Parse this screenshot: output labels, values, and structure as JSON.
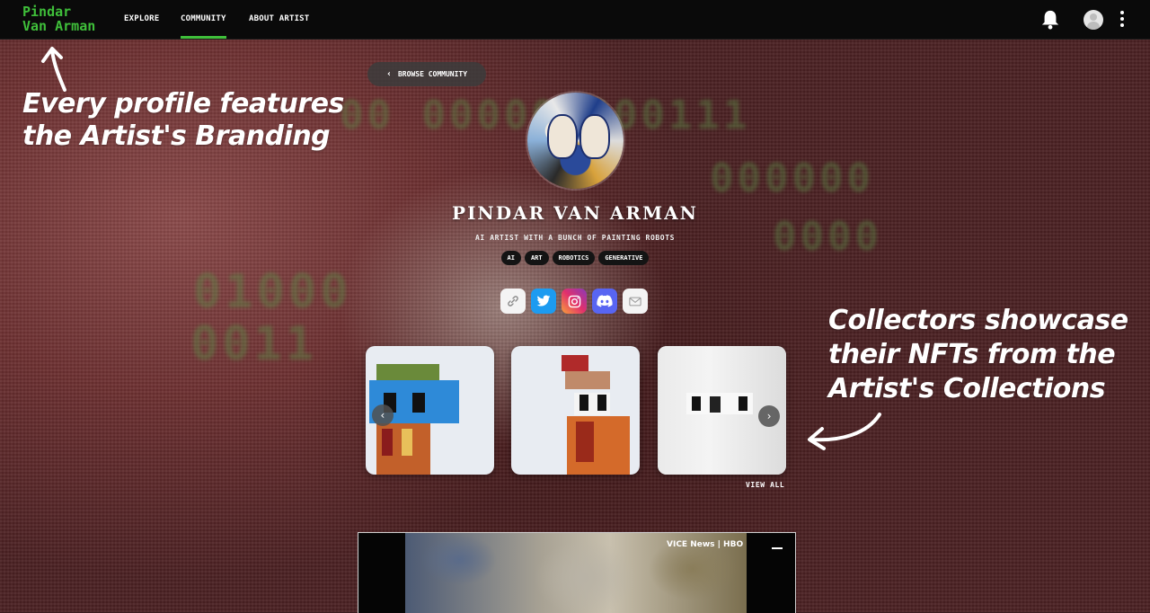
{
  "nav": {
    "brand_line1": "Pindar",
    "brand_line2": "Van Arman",
    "links": [
      "EXPLORE",
      "COMMUNITY",
      "ABOUT ARTIST"
    ],
    "active_link": "COMMUNITY",
    "icons": [
      "bell-icon",
      "user-avatar-icon",
      "more-vertical-icon"
    ]
  },
  "browse": {
    "label": "BROWSE COMMUNITY",
    "icon": "chevron-left-icon"
  },
  "profile": {
    "name": "PINDAR VAN ARMAN",
    "tagline": "AI ARTIST WITH A BUNCH OF PAINTING ROBOTS",
    "tags": [
      "AI",
      "ART",
      "ROBOTICS",
      "GENERATIVE"
    ]
  },
  "socials": [
    "link-icon",
    "twitter-icon",
    "instagram-icon",
    "discord-icon",
    "mail-icon"
  ],
  "carousel": {
    "view_all_label": "VIEW ALL",
    "prev_icon": "chevron-left-icon",
    "next_icon": "chevron-right-icon",
    "items": [
      "nft-card-1",
      "nft-card-2",
      "nft-card-3"
    ]
  },
  "background": {
    "binary_lines": [
      "00 000000000111",
      "000000",
      "0000",
      "01000",
      "0011"
    ]
  },
  "video": {
    "logo_text": "VICE News | HBO"
  },
  "annotations": {
    "branding_line1": "Every profile features",
    "branding_line2": "the Artist's Branding",
    "collectors_line1": "Collectors showcase",
    "collectors_line2": "their NFTs from the",
    "collectors_line3": "Artist's Collections"
  },
  "colors": {
    "accent": "#3fbf3a",
    "nav_bg": "#0a0a0a"
  }
}
